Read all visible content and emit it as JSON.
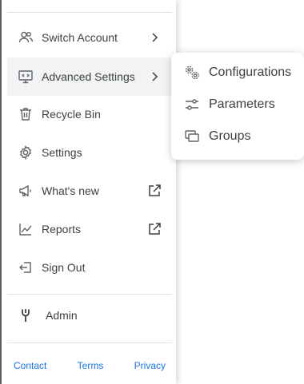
{
  "menu": {
    "items": [
      {
        "label": "Switch Account",
        "icon": "switch-account-icon",
        "trail": "chevron-right-icon"
      },
      {
        "label": "Advanced Settings",
        "icon": "monitor-code-icon",
        "trail": "chevron-right-icon",
        "active": true
      },
      {
        "label": "Recycle Bin",
        "icon": "trash-icon"
      },
      {
        "label": "Settings",
        "icon": "gear-icon"
      },
      {
        "label": "What's new",
        "icon": "megaphone-icon",
        "trail": "external-link-icon"
      },
      {
        "label": "Reports",
        "icon": "chart-line-icon",
        "trail": "external-link-icon"
      },
      {
        "label": "Sign Out",
        "icon": "sign-out-icon"
      }
    ],
    "admin": {
      "label": "Admin",
      "icon": "wrench-icon"
    },
    "footer": {
      "contact": "Contact",
      "terms": "Terms",
      "privacy": "Privacy"
    }
  },
  "submenu": {
    "items": [
      {
        "label": "Configurations",
        "icon": "gears-icon"
      },
      {
        "label": "Parameters",
        "icon": "sliders-icon"
      },
      {
        "label": "Groups",
        "icon": "screens-icon"
      }
    ]
  },
  "colors": {
    "link": "#1a73e8",
    "text": "#3c4043",
    "active_bg": "#f1f3f4",
    "icon": "#5f6368"
  }
}
